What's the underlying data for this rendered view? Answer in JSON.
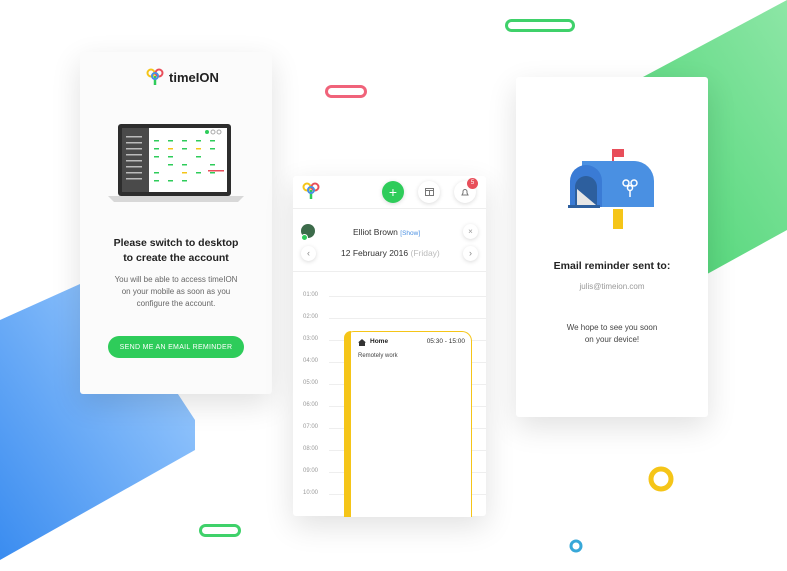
{
  "left_panel": {
    "logo_text": "timeION",
    "heading_line1": "Please switch to desktop",
    "heading_line2": "to create the account",
    "body_line1": "You will be able to access timeION",
    "body_line2": "on your mobile as soon as you",
    "body_line3": "configure the account.",
    "button_label": "SEND ME AN EMAIL REMINDER"
  },
  "middle_panel": {
    "notification_count": "5",
    "user_name": "Elliot Brown",
    "show_link": "[Show]",
    "date": "12 February 2016",
    "weekday": "(Friday)",
    "hours": [
      "01:00",
      "02:00",
      "03:00",
      "04:00",
      "05:00",
      "06:00",
      "07:00",
      "08:00",
      "09:00",
      "10:00"
    ],
    "event": {
      "title": "Home",
      "time": "05:30 - 15:00",
      "note": "Remotely work"
    }
  },
  "right_panel": {
    "heading": "Email reminder sent to:",
    "email": "julis@timeion.com",
    "message_line1": "We hope to see you soon",
    "message_line2": "on your device!"
  },
  "colors": {
    "green": "#2ecc5a",
    "blue": "#4a90e2",
    "yellow": "#f5c518",
    "red": "#e84e5a"
  }
}
